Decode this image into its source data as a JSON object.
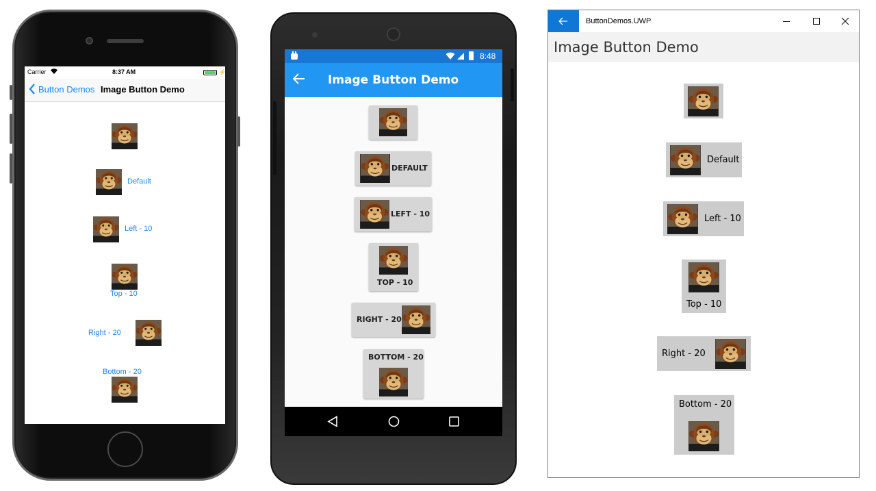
{
  "ios": {
    "status": {
      "carrier": "Carrier",
      "time": "8:37 AM"
    },
    "nav": {
      "back_label": "Button Demos",
      "title": "Image Button Demo"
    },
    "buttons": [
      "",
      "Default",
      "Left - 10",
      "Top - 10",
      "Right - 20",
      "Bottom - 20"
    ]
  },
  "android": {
    "status": {
      "time": "8:48"
    },
    "toolbar": {
      "title": "Image Button Demo"
    },
    "buttons": [
      "",
      "DEFAULT",
      "LEFT - 10",
      "TOP - 10",
      "RIGHT - 20",
      "BOTTOM - 20"
    ]
  },
  "uwp": {
    "window_title": "ButtonDemos.UWP",
    "page_title": "Image Button Demo",
    "buttons": [
      "",
      "Default",
      "Left - 10",
      "Top - 10",
      "Right - 20",
      "Bottom - 20"
    ]
  },
  "icons": {
    "back_arrow": "arrow-left-icon",
    "image": "monkey-image",
    "minimize": "minimize-icon",
    "maximize": "maximize-icon",
    "close": "close-icon"
  },
  "colors": {
    "ios_tint": "#1b86f4",
    "android_primary": "#2196f3",
    "android_status": "#1976d2",
    "uwp_accent": "#0f78d7",
    "button_gray": "#cccccc"
  }
}
